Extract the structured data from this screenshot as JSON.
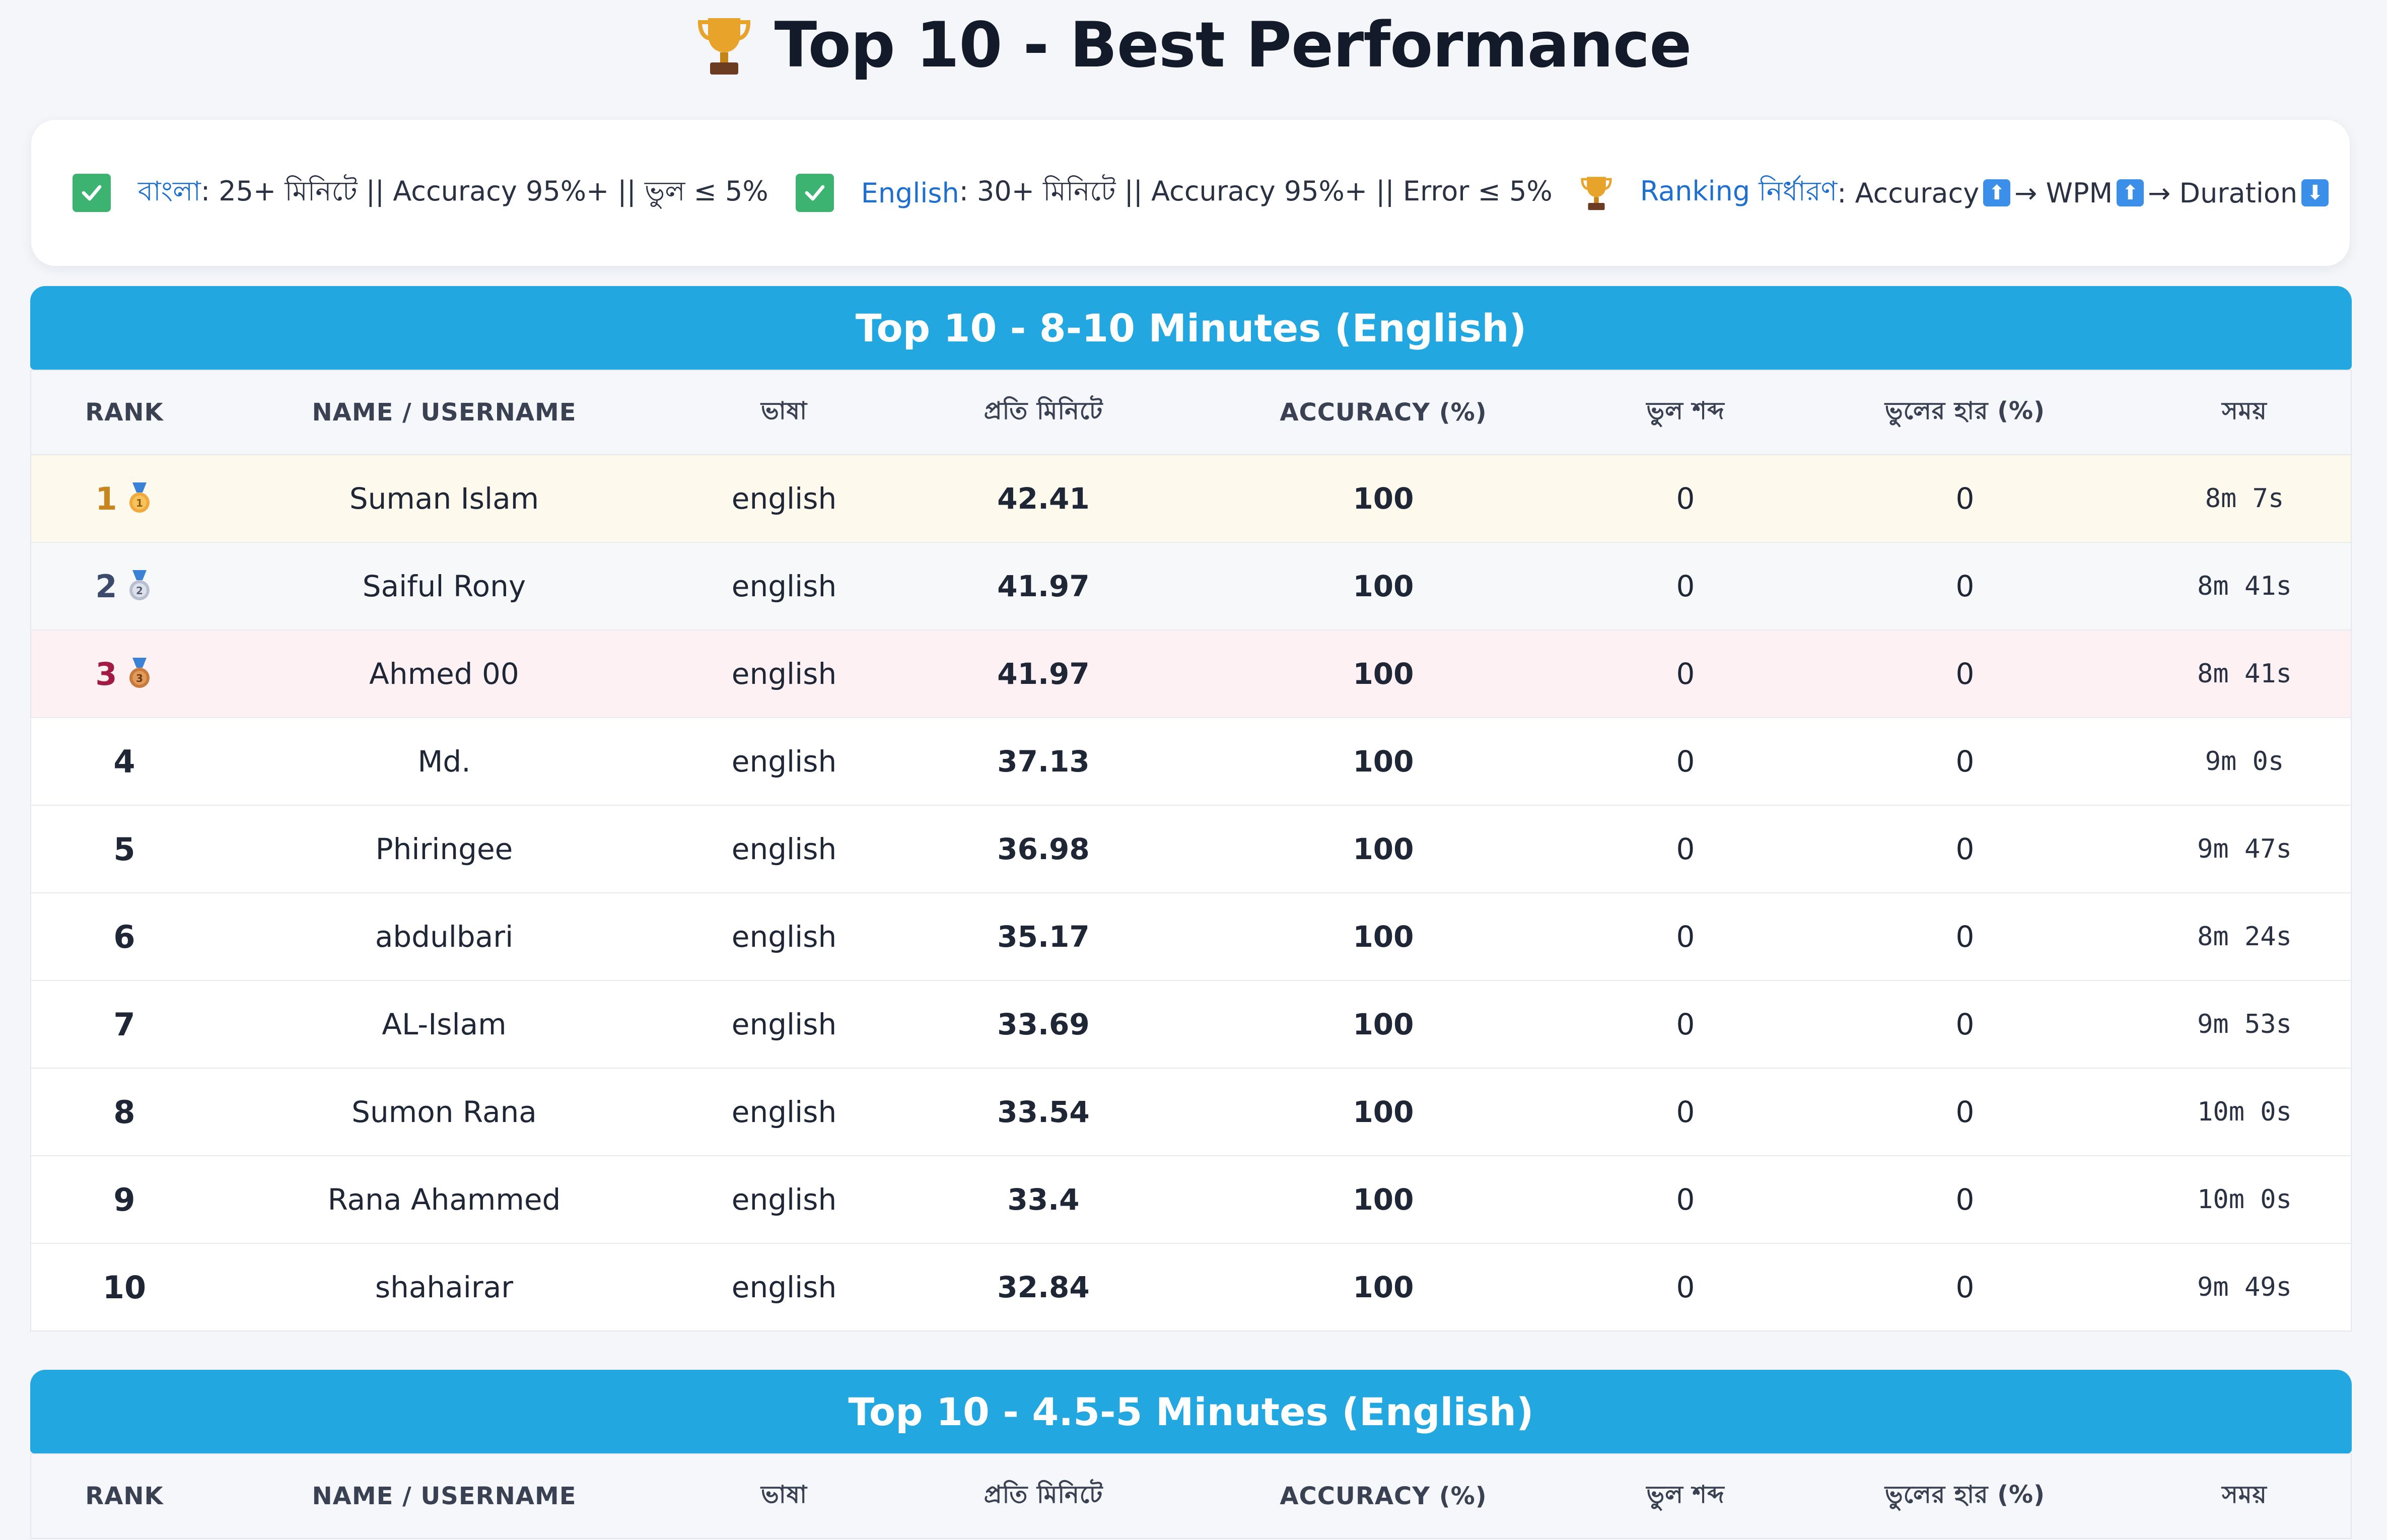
{
  "page_title": "Top 10 - Best Performance",
  "rules": {
    "bangla_key": "বাংলা",
    "bangla_text": ": 25+ মিনিটে || Accuracy 95%+ || ভুল ≤ 5%",
    "english_key": "English",
    "english_text": ": 30+ মিনিটে || Accuracy 95%+ || Error ≤ 5%",
    "ranking_key": "Ranking নির্ধারণ",
    "ranking_text_1": ": Accuracy",
    "ranking_text_2": "→ WPM",
    "ranking_text_3": "→ Duration",
    "up_arrow": "⬆",
    "down_arrow": "⬇"
  },
  "columns": [
    "RANK",
    "NAME / USERNAME",
    "ভাষা",
    "প্রতি মিনিটে",
    "ACCURACY (%)",
    "ভুল শব্দ",
    "ভুলের হার (%)",
    "সময়"
  ],
  "sections": [
    {
      "title": "Top 10 - 8-10 Minutes (English)",
      "rows": [
        {
          "rank": "1",
          "name": "Suman Islam",
          "lang": "english",
          "wpm": "42.41",
          "accuracy": "100",
          "wrong_words": "0",
          "error_rate": "0",
          "time": "8m 7s"
        },
        {
          "rank": "2",
          "name": "Saiful Rony",
          "lang": "english",
          "wpm": "41.97",
          "accuracy": "100",
          "wrong_words": "0",
          "error_rate": "0",
          "time": "8m 41s"
        },
        {
          "rank": "3",
          "name": "Ahmed 00",
          "lang": "english",
          "wpm": "41.97",
          "accuracy": "100",
          "wrong_words": "0",
          "error_rate": "0",
          "time": "8m 41s"
        },
        {
          "rank": "4",
          "name": "Md.",
          "lang": "english",
          "wpm": "37.13",
          "accuracy": "100",
          "wrong_words": "0",
          "error_rate": "0",
          "time": "9m 0s"
        },
        {
          "rank": "5",
          "name": "Phiringee",
          "lang": "english",
          "wpm": "36.98",
          "accuracy": "100",
          "wrong_words": "0",
          "error_rate": "0",
          "time": "9m 47s"
        },
        {
          "rank": "6",
          "name": "abdulbari",
          "lang": "english",
          "wpm": "35.17",
          "accuracy": "100",
          "wrong_words": "0",
          "error_rate": "0",
          "time": "8m 24s"
        },
        {
          "rank": "7",
          "name": "AL-Islam",
          "lang": "english",
          "wpm": "33.69",
          "accuracy": "100",
          "wrong_words": "0",
          "error_rate": "0",
          "time": "9m 53s"
        },
        {
          "rank": "8",
          "name": "Sumon Rana",
          "lang": "english",
          "wpm": "33.54",
          "accuracy": "100",
          "wrong_words": "0",
          "error_rate": "0",
          "time": "10m 0s"
        },
        {
          "rank": "9",
          "name": "Rana Ahammed",
          "lang": "english",
          "wpm": "33.4",
          "accuracy": "100",
          "wrong_words": "0",
          "error_rate": "0",
          "time": "10m 0s"
        },
        {
          "rank": "10",
          "name": "shahairar",
          "lang": "english",
          "wpm": "32.84",
          "accuracy": "100",
          "wrong_words": "0",
          "error_rate": "0",
          "time": "9m 49s"
        }
      ]
    },
    {
      "title": "Top 10 - 4.5-5 Minutes (English)",
      "rows": []
    }
  ],
  "colors": {
    "accent": "#22a7e1",
    "gold": "#c7861f",
    "silver": "#3c4a6b",
    "bronze": "#a11b45",
    "check": "#3cb371"
  },
  "icons": {
    "title": "trophy-icon",
    "rule_check": "check-square-icon",
    "ranking": "trophy-icon",
    "medals": [
      "gold-medal-icon",
      "silver-medal-icon",
      "bronze-medal-icon"
    ]
  }
}
